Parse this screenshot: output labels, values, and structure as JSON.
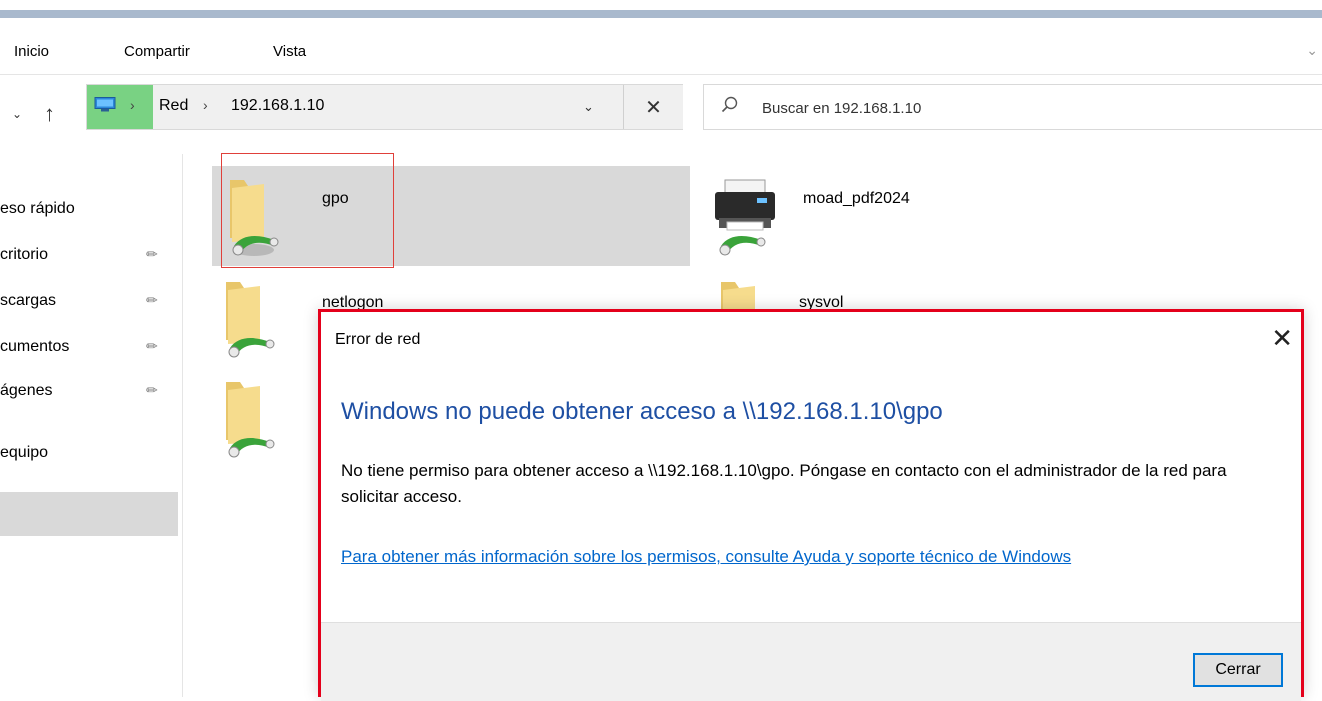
{
  "ribbon": {
    "tabs": [
      {
        "label": "Inicio"
      },
      {
        "label": "Compartir"
      },
      {
        "label": "Vista"
      }
    ],
    "collapse_icon": "chevron-down-icon"
  },
  "navigation": {
    "recent_icon": "chevron-down-icon",
    "up_icon": "arrow-up-icon"
  },
  "address_bar": {
    "segments": [
      "Red",
      "192.168.1.10"
    ],
    "separator": "›",
    "dropdown_icon": "chevron-down-icon",
    "close_icon": "close-icon"
  },
  "search": {
    "placeholder": "Buscar en 192.168.1.10",
    "icon": "search-icon"
  },
  "sidebar": {
    "items": [
      {
        "label": "eso rápido",
        "pinned": false
      },
      {
        "label": "critorio",
        "pinned": true
      },
      {
        "label": "scargas",
        "pinned": true
      },
      {
        "label": "cumentos",
        "pinned": true
      },
      {
        "label": "ágenes",
        "pinned": true
      },
      {
        "label": "equipo",
        "pinned": false
      }
    ],
    "pin_glyph": "📌"
  },
  "files": [
    {
      "name": "gpo",
      "type": "shared-folder",
      "selected": true
    },
    {
      "name": "moad_pdf2024",
      "type": "printer",
      "selected": false
    },
    {
      "name": "netlogon",
      "type": "shared-folder",
      "selected": false
    },
    {
      "name": "sysvol",
      "type": "shared-folder",
      "selected": false
    },
    {
      "name": "",
      "type": "shared-folder",
      "selected": false
    }
  ],
  "dialog": {
    "title": "Error de red",
    "heading": "Windows no puede obtener acceso a \\\\192.168.1.10\\gpo",
    "message": "No tiene permiso para obtener acceso a \\\\192.168.1.10\\gpo. Póngase en contacto con el administrador de la red para solicitar acceso.",
    "help_link": "Para obtener más información sobre los permisos, consulte Ayuda y soporte técnico de Windows",
    "close_button": "Cerrar"
  },
  "colors": {
    "selection": "#d9d9d9",
    "address_highlight": "#79d283",
    "dialog_border": "#e4001b",
    "heading": "#1e4fa3",
    "link": "#0066cc",
    "button_focus": "#0078d7"
  }
}
